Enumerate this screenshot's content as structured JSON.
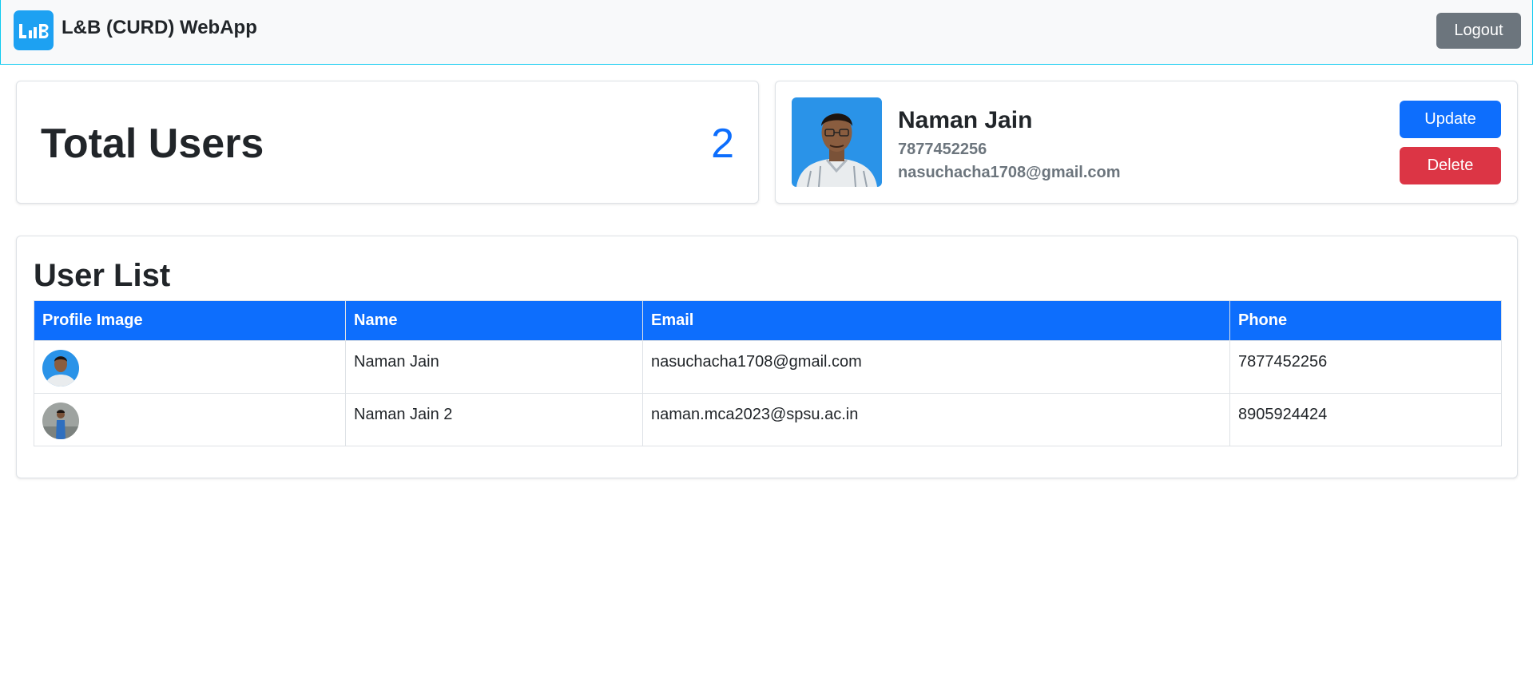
{
  "navbar": {
    "brand_logo_icon": "lb-logo-icon",
    "title": "L&B (CURD) WebApp",
    "logout_label": "Logout"
  },
  "total_users": {
    "label": "Total Users",
    "count": "2"
  },
  "profile": {
    "photo_icon": "user-photo",
    "name": "Naman Jain",
    "phone": "7877452256",
    "email": "nasuchacha1708@gmail.com",
    "update_label": "Update",
    "delete_label": "Delete"
  },
  "user_list": {
    "title": "User List",
    "columns": [
      "Profile Image",
      "Name",
      "Email",
      "Phone"
    ],
    "rows": [
      {
        "avatar_icon": "user-avatar",
        "name": "Naman Jain",
        "email": "nasuchacha1708@gmail.com",
        "phone": "7877452256"
      },
      {
        "avatar_icon": "user-avatar",
        "name": "Naman Jain 2",
        "email": "naman.mca2023@spsu.ac.in",
        "phone": "8905924424"
      }
    ]
  },
  "colors": {
    "primary": "#0d6efd",
    "danger": "#dc3545",
    "secondary": "#6c757d",
    "brand": "#1da1f2"
  }
}
